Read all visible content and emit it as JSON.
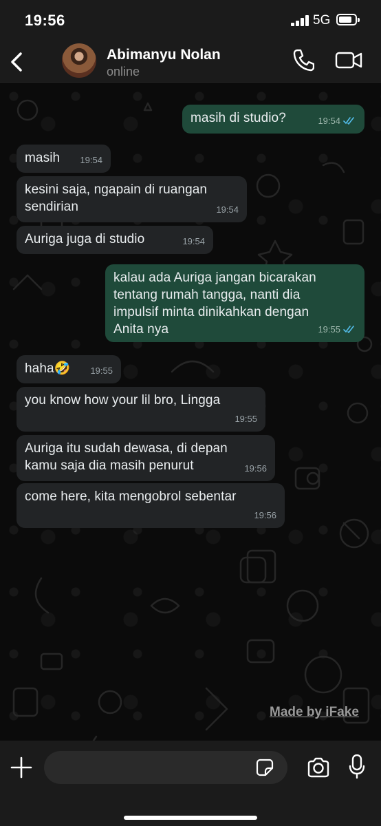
{
  "status_bar": {
    "time": "19:56",
    "network": "5G"
  },
  "header": {
    "contact_name": "Abimanyu Nolan",
    "contact_status": "online"
  },
  "messages": [
    {
      "dir": "out",
      "text": "masih di studio?",
      "time": "19:54",
      "read": true
    },
    {
      "dir": "in",
      "text": "masih",
      "time": "19:54"
    },
    {
      "dir": "in",
      "text": "kesini saja, ngapain di ruangan\nsendirian",
      "time": "19:54"
    },
    {
      "dir": "in",
      "text": "Auriga juga di studio",
      "time": "19:54"
    },
    {
      "dir": "out",
      "text": "kalau ada Auriga jangan bicarakan\ntentang rumah tangga, nanti dia\nimpulsif minta dinikahkan dengan\nAnita nya",
      "time": "19:55",
      "read": true
    },
    {
      "dir": "in",
      "text": "haha🤣",
      "time": "19:55"
    },
    {
      "dir": "in",
      "text": "you know how your lil bro, Lingga",
      "time": "19:55"
    },
    {
      "dir": "in",
      "text": "Auriga itu sudah dewasa, di depan\nkamu saja dia masih penurut",
      "time": "19:56"
    },
    {
      "dir": "in",
      "text": "come here, kita mengobrol sebentar",
      "time": "19:56"
    }
  ],
  "watermark": "Made by iFake",
  "composer": {
    "input_value": ""
  },
  "colors": {
    "incoming": "#222426",
    "outgoing": "#1f4a3a",
    "read_tick": "#53bdeb"
  }
}
